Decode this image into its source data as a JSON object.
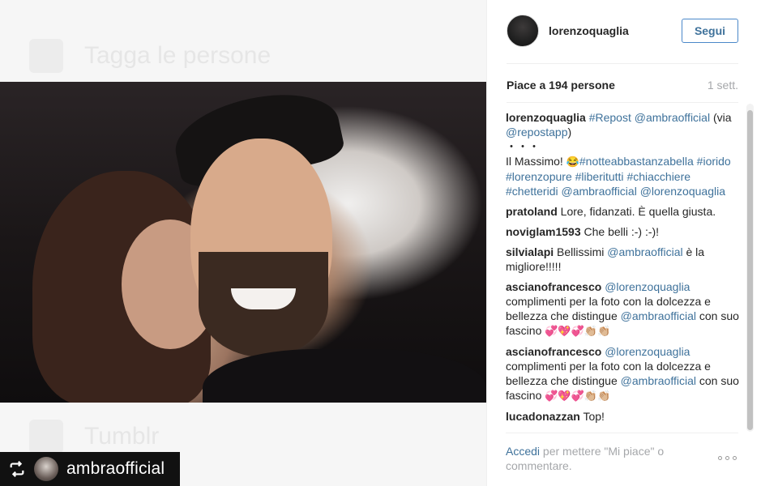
{
  "background": {
    "ghost_items": [
      {
        "label": "Tagga le persone",
        "icon": "tag-person-icon"
      },
      {
        "label": "Tumblr",
        "icon": "tumblr-icon"
      }
    ]
  },
  "repost_badge": {
    "icon": "repost-icon",
    "username": "ambraofficial"
  },
  "post": {
    "username": "lorenzoquaglia",
    "follow_label": "Segui",
    "likes": "Piace a 194 persone",
    "time": "1 sett."
  },
  "caption": {
    "username": "lorenzoquaglia",
    "parts": [
      {
        "text": "#Repost",
        "link": true
      },
      {
        "text": " ",
        "link": false
      },
      {
        "text": "@ambraofficial",
        "link": true
      },
      {
        "text": " (via ",
        "link": false
      },
      {
        "text": "@repostapp",
        "link": true
      },
      {
        "text": ")",
        "link": false
      }
    ],
    "dots": "・・・",
    "line2_text": "Il Massimo! ",
    "line2_emoji": "😂",
    "tags": [
      "#notteabbastanzabella",
      "#iorido",
      "#lorenzopure",
      "#liberitutti",
      "#chiacchiere",
      "#chetteridi"
    ],
    "mention": "@ambraofficial",
    "mention2": "@lorenzoquaglia"
  },
  "comments": [
    {
      "user": "pratoland",
      "text": "Lore, fidanzati. È quella giusta."
    },
    {
      "user": "noviglam1593",
      "text": "Che belli :-) :-)!"
    },
    {
      "user": "silvialapi",
      "pre": "Bellissimi ",
      "mention": "@ambraofficial",
      "post": " è la migliore!!!!!"
    },
    {
      "user": "ascianofrancesco",
      "mention": "@lorenzoquaglia",
      "pre": "",
      "post": " complimenti per la foto con la dolcezza e bellezza che distingue ",
      "mention2": "@ambraofficial",
      "tail": " con suo fascino ",
      "emoji": "💞💖💞👏🏼👏🏼"
    },
    {
      "user": "ascianofrancesco",
      "mention": "@lorenzoquaglia",
      "pre": "",
      "post": " complimenti per la foto con la dolcezza e bellezza che distingue ",
      "mention2": "@ambraofficial",
      "tail": " con suo fascino ",
      "emoji": "💞💖💞👏🏼👏🏼"
    },
    {
      "user": "lucadonazzan",
      "text": "Top!"
    }
  ],
  "footer": {
    "login_label": "Accedi",
    "rest": " per mettere \"Mi piace\" o commentare."
  },
  "more_icon": "ellipsis-icon"
}
